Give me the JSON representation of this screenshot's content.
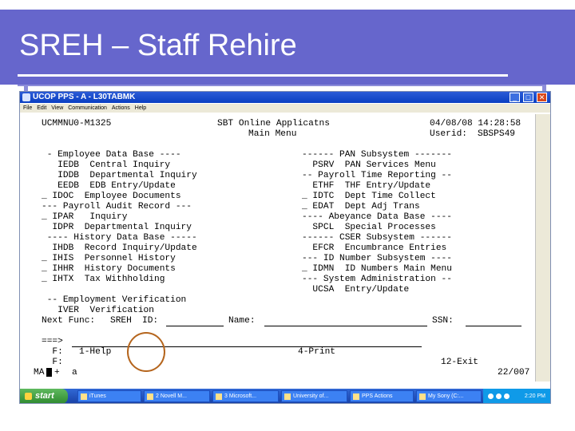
{
  "slide": {
    "title": "SREH – Staff Rehire"
  },
  "window": {
    "title": "UCOP PPS - A - L30TABMK",
    "controls": {
      "minimize": "_",
      "maximize": "□",
      "close": "✕"
    },
    "menu": [
      "File",
      "Edit",
      "View",
      "Communication",
      "Actions",
      "Help"
    ]
  },
  "terminal": {
    "header_left": "UCMMNU0-M1325",
    "header_center": "SBT Online Applicatns",
    "header_date": "04/08/08 14:28:58",
    "subheader_center": "Main Menu",
    "userid_label": "Userid:",
    "userid_value": "SBSPS49",
    "left_items": [
      " - Employee Data Base ----",
      "   IEDB  Central Inquiry",
      "   IDDB  Departmental Inquiry",
      "   EEDB  EDB Entry/Update",
      "_ IDOC  Employee Documents",
      "--- Payroll Audit Record ---",
      "_ IPAR   Inquiry",
      "  IDPR  Departmental Inquiry",
      " ---- History Data Base -----",
      "  IHDB  Record Inquiry/Update",
      "_ IHIS  Personnel History",
      "_ IHHR  History Documents",
      "_ IHTX  Tax Withholding"
    ],
    "right_items": [
      "------ PAN Subsystem -------",
      "  PSRV  PAN Services Menu",
      "-- Payroll Time Reporting --",
      "  ETHF  THF Entry/Update",
      "_ IDTC  Dept Time Collect",
      "_ EDAT  Dept Adj Trans",
      "---- Abeyance Data Base ----",
      "  SPCL  Special Processes",
      "------ CSER Subsystem ------",
      "  EFCR  Encumbrance Entries",
      "--- ID Number Subsystem ----",
      "_ IDMN  ID Numbers Main Menu",
      "--- System Administration --",
      "  UCSA  Entry/Update"
    ],
    "employment_verification": " -- Employment Verification",
    "iver_line": "   IVER  Verification",
    "next_func_label": "Next Func:",
    "next_func_value": "SREH",
    "id_label": "ID:",
    "name_label": "Name:",
    "ssn_label": "SSN:",
    "command_prompt": "===>",
    "f_line1_left": "  F:   1-Help",
    "f_line1_right": "4-Print",
    "f_line2_left": "  F:",
    "f_line2_right": "12-Exit",
    "status_left": "MA",
    "status_plus": "+",
    "status_mid": "a",
    "status_right": "22/007"
  },
  "taskbar": {
    "start_label": "start",
    "tasks": [
      "iTunes",
      "2 Novell M...",
      "3 Microsoft...",
      "University of...",
      "PPS Actions",
      "My Sony (C:..."
    ],
    "clock": "2:20 PM"
  },
  "colors": {
    "slide_bar": "#6666cc",
    "annotation_circle": "#b5651d",
    "titlebar": "#0a3fc2"
  }
}
